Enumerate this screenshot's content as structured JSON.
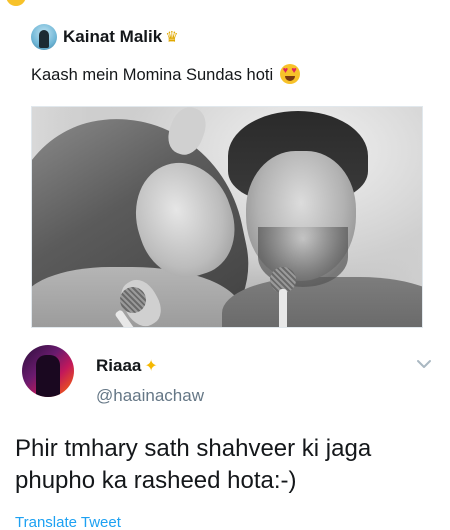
{
  "quoted_tweet": {
    "author_name": "Kainat Malik",
    "author_badge_icon": "crown-icon",
    "text": "Kaash mein Momina Sundas hoti",
    "text_emoji_icon": "heart-eyes-icon",
    "photo_icon": "couple-photo"
  },
  "reply_tweet": {
    "author_name": "Riaaa",
    "author_badge_icon": "sparkles-icon",
    "handle": "@haainachaw",
    "text": "Phir tmhary sath shahveer ki jaga phupho ka rasheed hota:-)",
    "translate_label": "Translate Tweet",
    "menu_icon": "chevron-down-icon"
  },
  "colors": {
    "text_primary": "#14171a",
    "text_secondary": "#657786",
    "link": "#1da1f2"
  }
}
